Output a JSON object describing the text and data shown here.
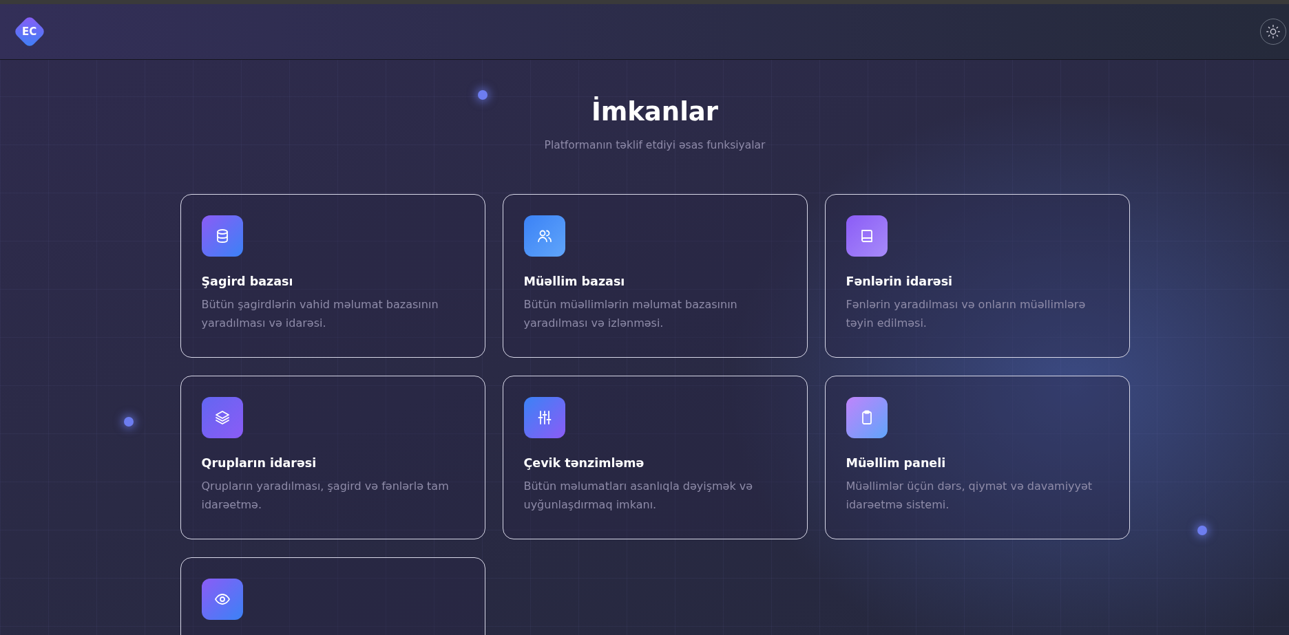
{
  "header": {
    "logo": "EC"
  },
  "section": {
    "title": "İmkanlar",
    "subtitle": "Platformanın təklif etdiyi əsas funksiyalar"
  },
  "features": [
    {
      "title": "Şagird bazası",
      "description": "Bütün şagirdlərin vahid məlumat bazasının yaradılması və idarəsi."
    },
    {
      "title": "Müəllim bazası",
      "description": "Bütün müəllimlərin məlumat bazasının yaradılması və izlənməsi."
    },
    {
      "title": "Fənlərin idarəsi",
      "description": "Fənlərin yaradılması və onların müəllimlərə təyin edilməsi."
    },
    {
      "title": "Qrupların idarəsi",
      "description": "Qrupların yaradılması, şagird və fənlərlə tam idarəetmə."
    },
    {
      "title": "Çevik tənzimləmə",
      "description": "Bütün məlumatları asanlıqla dəyişmək və uyğunlaşdırmaq imkanı."
    },
    {
      "title": "Müəllim paneli",
      "description": "Müəllimlər üçün dərs, qiymət və davamiyyət idarəetmə sistemi."
    }
  ]
}
